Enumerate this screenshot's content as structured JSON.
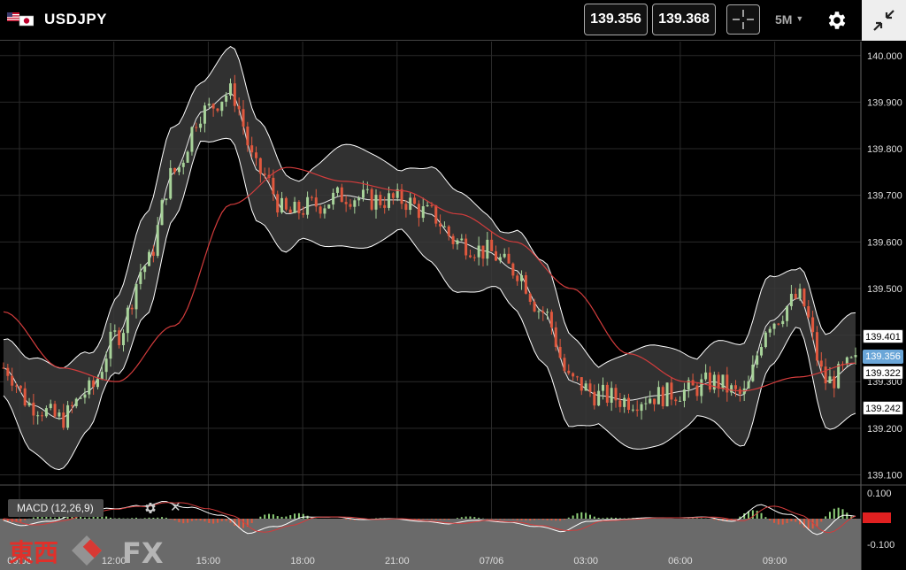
{
  "header": {
    "symbol": "USDJPY",
    "flag_icon": "us-jp-flag-icon",
    "bid_price": "139.356",
    "ask_price": "139.368",
    "timeframe": "5M",
    "crosshair_icon": "crosshair-icon",
    "settings_icon": "gear-icon",
    "collapse_icon": "collapse-icon"
  },
  "chart_data": {
    "type": "candlestick",
    "symbol": "USDJPY",
    "timeframe": "5M",
    "x_tick_labels": [
      "09:00",
      "12:00",
      "15:00",
      "18:00",
      "21:00",
      "07/06",
      "03:00",
      "06:00",
      "09:00"
    ],
    "y_tick_labels": [
      "140.000",
      "139.900",
      "139.800",
      "139.700",
      "139.600",
      "139.500",
      "139.400",
      "139.300",
      "139.200",
      "139.100"
    ],
    "ylim": [
      139.08,
      140.03
    ],
    "price_tags": [
      {
        "value": "139.401",
        "style": "white"
      },
      {
        "value": "139.356",
        "style": "blue"
      },
      {
        "value": "139.322",
        "style": "white"
      },
      {
        "value": "139.242",
        "style": "white"
      }
    ],
    "indicators": {
      "bollinger": {
        "color_band": "#ffffff",
        "fill": "#3a3a3a"
      },
      "moving_average": {
        "color": "#d33c3c"
      }
    },
    "price_path": [
      [
        0,
        139.33
      ],
      [
        1,
        139.25
      ],
      [
        2,
        139.22
      ],
      [
        3,
        139.28
      ],
      [
        4,
        139.4
      ],
      [
        5,
        139.55
      ],
      [
        6,
        139.75
      ],
      [
        7,
        139.88
      ],
      [
        8,
        139.92
      ],
      [
        9,
        139.75
      ],
      [
        10,
        139.66
      ],
      [
        11,
        139.68
      ],
      [
        12,
        139.7
      ],
      [
        13,
        139.69
      ],
      [
        14,
        139.69
      ],
      [
        15,
        139.66
      ],
      [
        16,
        139.6
      ],
      [
        17,
        139.58
      ],
      [
        18,
        139.54
      ],
      [
        19,
        139.45
      ],
      [
        20,
        139.3
      ],
      [
        21,
        139.27
      ],
      [
        22,
        139.26
      ],
      [
        23,
        139.27
      ],
      [
        24,
        139.28
      ],
      [
        25,
        139.3
      ],
      [
        26,
        139.27
      ],
      [
        27,
        139.43
      ],
      [
        28,
        139.48
      ],
      [
        29,
        139.3
      ],
      [
        30,
        139.34
      ]
    ],
    "moving_average_path": [
      [
        0,
        139.45
      ],
      [
        2,
        139.33
      ],
      [
        4,
        139.3
      ],
      [
        6,
        139.42
      ],
      [
        8,
        139.68
      ],
      [
        10,
        139.76
      ],
      [
        12,
        139.73
      ],
      [
        14,
        139.71
      ],
      [
        16,
        139.66
      ],
      [
        18,
        139.6
      ],
      [
        20,
        139.5
      ],
      [
        22,
        139.36
      ],
      [
        24,
        139.3
      ],
      [
        26,
        139.28
      ],
      [
        28,
        139.31
      ],
      [
        30,
        139.34
      ]
    ],
    "macd": {
      "label": "MACD (12,26,9)",
      "y_tick_labels": [
        "0.100",
        "0.00",
        "-0.100"
      ]
    }
  },
  "brand": {
    "kanji": "東西",
    "text": "FX"
  }
}
